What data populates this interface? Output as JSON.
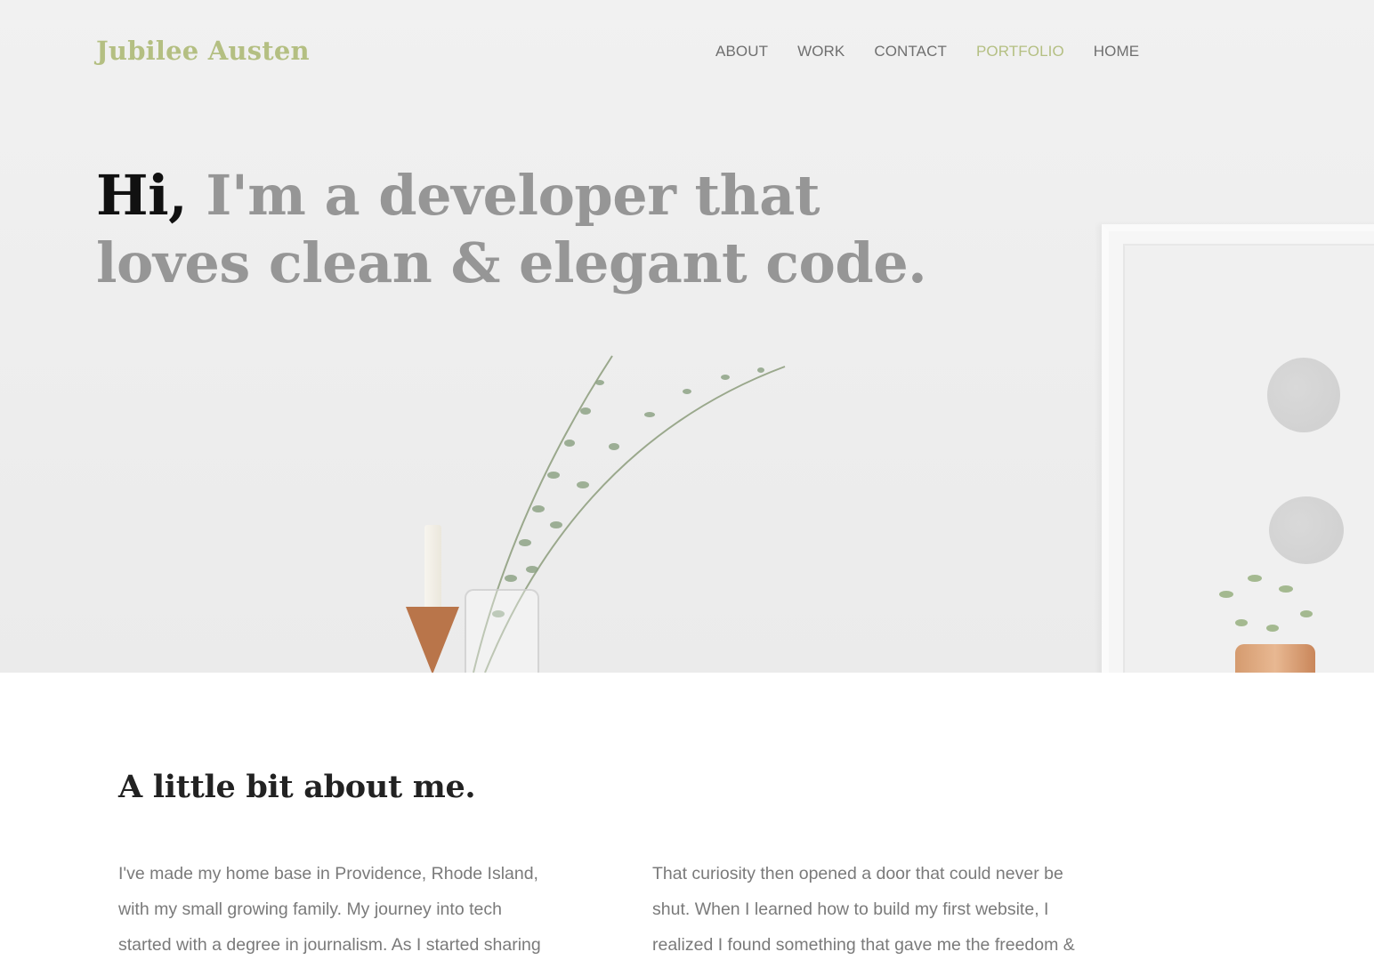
{
  "brand": "Jubilee Austen",
  "nav": {
    "items": [
      {
        "label": "ABOUT",
        "active": false
      },
      {
        "label": "WORK",
        "active": false
      },
      {
        "label": "CONTACT",
        "active": false
      },
      {
        "label": "PORTFOLIO",
        "active": true
      },
      {
        "label": "HOME",
        "active": false
      }
    ]
  },
  "hero": {
    "greeting": "Hi,",
    "tagline": "I'm a developer that loves clean & elegant code."
  },
  "about": {
    "title": "A little bit about me.",
    "left_text": "I've made my home base in Providence, Rhode Island, with my small growing family. My journey into tech started with a degree in journalism. As I started sharing",
    "right_text": "That curiosity then opened a door that could never be shut. When I learned how to build my first website, I realized I found something that gave me the freedom &"
  },
  "colors": {
    "accent": "#b4bf82",
    "nav_text": "#6f6f6f",
    "headline_muted": "#969696",
    "headline_dark": "#111111",
    "body_text": "#7a7a7a"
  }
}
